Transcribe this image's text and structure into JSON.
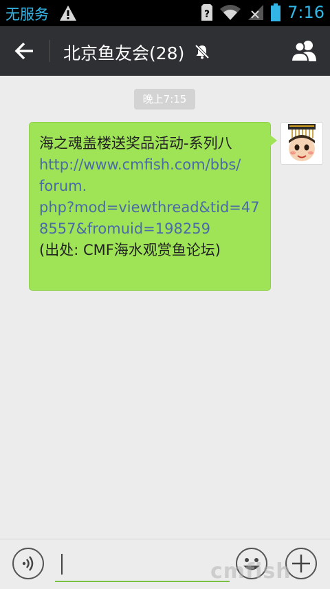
{
  "status_bar": {
    "carrier": "无服务",
    "time": "7:16",
    "icons": [
      "warning-icon",
      "sim-missing-icon",
      "wifi-icon",
      "signal-icon",
      "battery-icon"
    ]
  },
  "header": {
    "title": "北京鱼友会(28)",
    "icons": [
      "back-arrow-icon",
      "mute-bell-icon",
      "group-members-icon"
    ]
  },
  "chat": {
    "time_label": "晚上7:15",
    "message": {
      "lines": [
        "海之魂盖楼送奖品活动-系列八",
        "http://www.cmfish.com/bbs/",
        "forum.",
        "php?mod=viewthread&tid=47",
        "8557&fromuid=198259",
        "(出处: CMF海水观赏鱼论坛)"
      ]
    }
  },
  "input_bar": {
    "text_value": "",
    "icons": [
      "voice-icon",
      "emoji-icon",
      "plus-icon"
    ]
  },
  "watermark": "cmfish",
  "colors": {
    "accent": "#33b5e5",
    "header_bg": "#2f3034",
    "bubble_green": "#9fe457",
    "link": "#4a6aa8",
    "input_underline": "#7ac143"
  }
}
